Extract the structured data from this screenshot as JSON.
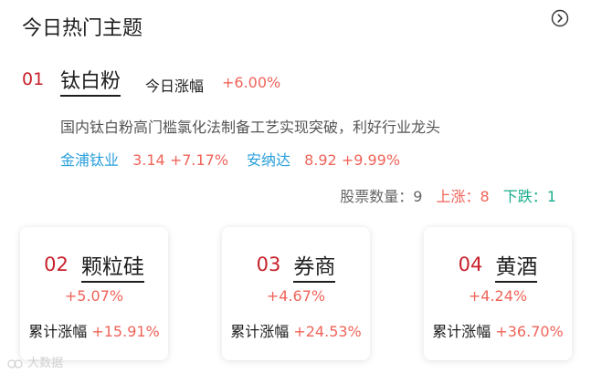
{
  "title": "今日热门主题",
  "main_theme": {
    "rank": "01",
    "name": "钛白粉",
    "today_label": "今日涨幅",
    "today_change": "+6.00%",
    "description": "国内钛白粉高门槛氯化法制备工艺实现突破，利好行业龙头",
    "stocks": [
      {
        "name": "金浦钛业",
        "price": "3.14",
        "change": "+7.17%"
      },
      {
        "name": "安纳达",
        "price": "8.92",
        "change": "+9.99%"
      }
    ],
    "counts": {
      "total_label": "股票数量：",
      "total": "9",
      "up_label": "上涨：",
      "up": "8",
      "down_label": "下跌：",
      "down": "1"
    }
  },
  "cards": [
    {
      "rank": "02",
      "name": "颗粒硅",
      "change": "+5.07%",
      "cum_label": "累计涨幅",
      "cum_change": "+15.91%"
    },
    {
      "rank": "03",
      "name": "券商",
      "change": "+4.67%",
      "cum_label": "累计涨幅",
      "cum_change": "+24.53%"
    },
    {
      "rank": "04",
      "name": "黄酒",
      "change": "+4.24%",
      "cum_label": "累计涨幅",
      "cum_change": "+36.70%"
    }
  ],
  "watermark": "大数据",
  "colors": {
    "rank_red": "#c8212b",
    "up_red": "#f0645a",
    "link_blue": "#2aa0dc",
    "down_green": "#1aae8c"
  },
  "icons": {
    "more": "chevron-right-circle-icon",
    "watermark": "logo-icon"
  }
}
